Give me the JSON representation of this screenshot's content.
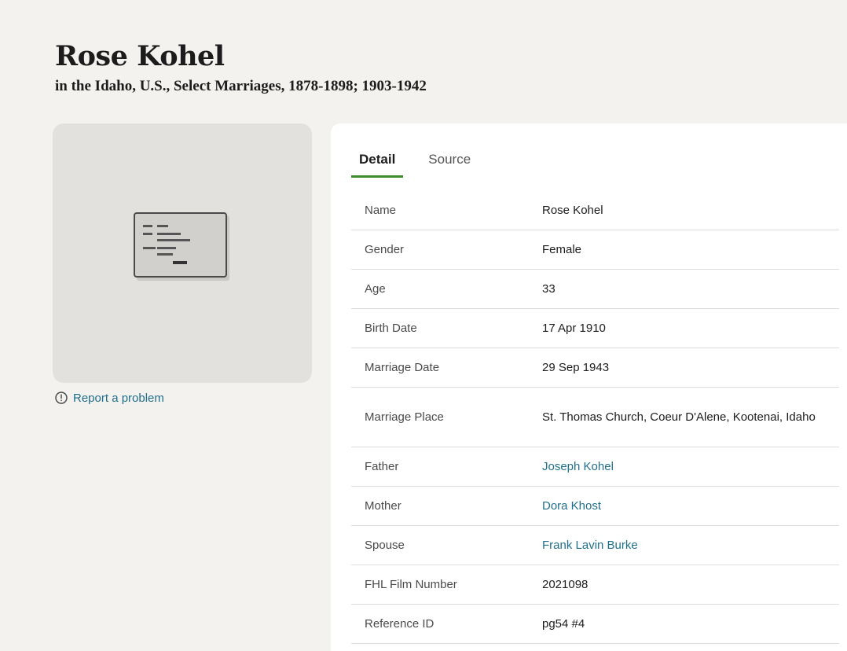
{
  "record": {
    "name": "Rose Kohel",
    "collection": "in the Idaho, U.S., Select Marriages, 1878-1898; 1903-1942"
  },
  "image": {
    "icon": "record-document-icon",
    "report_label": "Report a problem",
    "report_icon": "info-circle-icon"
  },
  "tabs": [
    {
      "label": "Detail",
      "active": true
    },
    {
      "label": "Source",
      "active": false
    }
  ],
  "details": [
    {
      "label": "Name",
      "value": "Rose Kohel",
      "link": false
    },
    {
      "label": "Gender",
      "value": "Female",
      "link": false
    },
    {
      "label": "Age",
      "value": "33",
      "link": false
    },
    {
      "label": "Birth Date",
      "value": "17 Apr 1910",
      "link": false
    },
    {
      "label": "Marriage Date",
      "value": "29 Sep 1943",
      "link": false
    },
    {
      "label": "Marriage Place",
      "value": "St. Thomas Church, Coeur D'Alene, Kootenai, Idaho",
      "link": false
    },
    {
      "label": "Father",
      "value": "Joseph Kohel",
      "link": true
    },
    {
      "label": "Mother",
      "value": "Dora Khost",
      "link": true
    },
    {
      "label": "Spouse",
      "value": "Frank Lavin Burke",
      "link": true
    },
    {
      "label": "FHL Film Number",
      "value": "2021098",
      "link": false
    },
    {
      "label": "Reference ID",
      "value": "pg54 #4",
      "link": false
    }
  ],
  "colors": {
    "background": "#f4f2ef",
    "link": "#1f6f8b",
    "tab_underline": "#3c8a29"
  }
}
